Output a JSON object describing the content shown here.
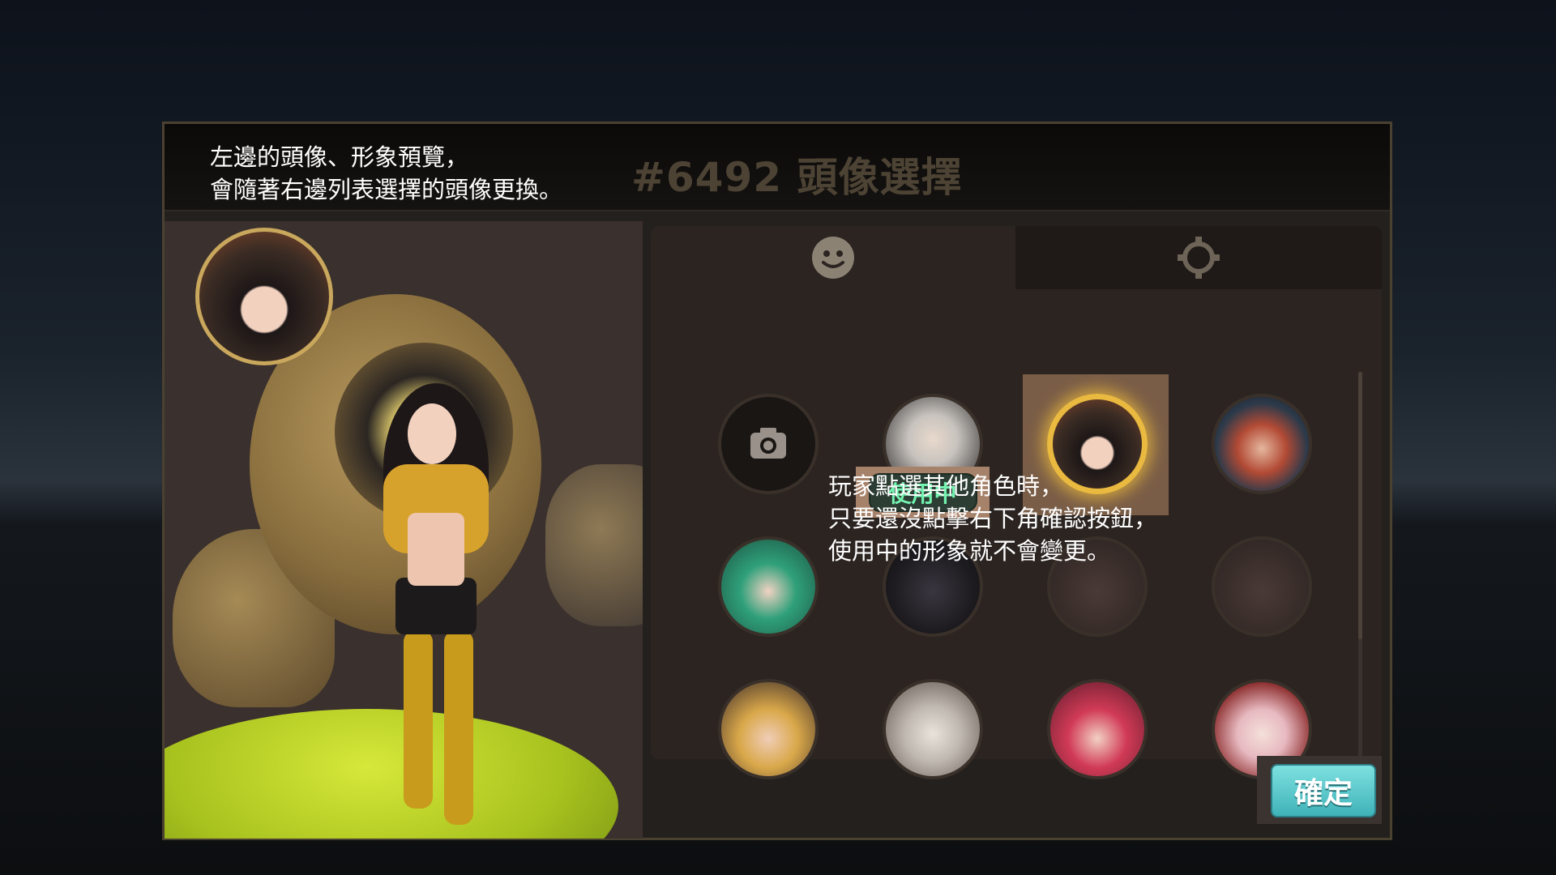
{
  "annotations": {
    "top_line1": "左邊的頭像、形象預覽，",
    "top_line2": "會隨著右邊列表選擇的頭像更換。",
    "middle_line1": "玩家點選其他角色時，",
    "middle_line2": "只要還沒點擊右下角確認按鈕，",
    "middle_line3": "使用中的形象就不會變更。"
  },
  "dialog": {
    "title": "#6492 頭像選擇"
  },
  "tabs": [
    {
      "icon": "smiley-face-icon",
      "active": true
    },
    {
      "icon": "gear-icon",
      "active": false
    }
  ],
  "avatars": [
    {
      "name": "camera",
      "icon": "camera-icon"
    },
    {
      "name": "white-haired-boy",
      "status": "in_use"
    },
    {
      "name": "steampunk-girl",
      "status": "selected"
    },
    {
      "name": "goggles-hat-boy"
    },
    {
      "name": "green-hair-girl"
    },
    {
      "name": "hooded-shadow"
    },
    {
      "name": "hidden-avatar-1"
    },
    {
      "name": "hidden-avatar-2"
    },
    {
      "name": "blonde-officer"
    },
    {
      "name": "bearded-old-man"
    },
    {
      "name": "red-hair-girl"
    },
    {
      "name": "pink-hair-girl"
    }
  ],
  "badge": {
    "in_use_label": "使用中"
  },
  "buttons": {
    "confirm_label": "確定"
  },
  "colors": {
    "selected_ring": "#e9b940",
    "badge_text": "#74f2b0",
    "confirm_button": "#4fc2c6"
  }
}
